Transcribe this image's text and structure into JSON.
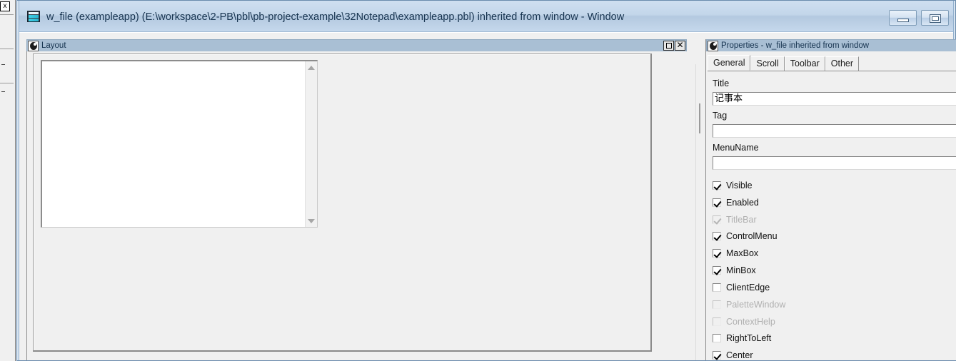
{
  "window": {
    "title": "w_file (exampleapp) (E:\\workspace\\2-PB\\pbl\\pb-project-example\\32Notepad\\exampleapp.pbl) inherited from window - Window",
    "icon": "window-painter-icon",
    "caption_buttons": [
      {
        "name": "minimize-button",
        "glyph": "minimize"
      },
      {
        "name": "restore-button",
        "glyph": "restore"
      }
    ]
  },
  "left_sliver": {
    "close_label": "x"
  },
  "layout_pane": {
    "title": "Layout",
    "icon": "powerbuilder-painter-icon",
    "buttons": [
      {
        "name": "maximize-button",
        "glyph": "maximize"
      },
      {
        "name": "close-button",
        "glyph": "close",
        "label": "✕"
      }
    ],
    "design": {
      "controls": [
        {
          "name": "multiline-edit",
          "type": "mle",
          "value": ""
        }
      ],
      "scrollbar": {
        "up_arrow": "scroll-up-arrow",
        "down_arrow": "scroll-down-arrow"
      }
    }
  },
  "properties_pane": {
    "title": "Properties - w_file inherited from window",
    "icon": "powerbuilder-painter-icon",
    "tabs": [
      {
        "label": "General",
        "active": true
      },
      {
        "label": "Scroll",
        "active": false
      },
      {
        "label": "Toolbar",
        "active": false
      },
      {
        "label": "Other",
        "active": false
      }
    ],
    "fields": [
      {
        "label": "Title",
        "value": "记事本",
        "name": "title-field"
      },
      {
        "label": "Tag",
        "value": "",
        "name": "tag-field"
      },
      {
        "label": "MenuName",
        "value": "",
        "name": "menuname-field"
      }
    ],
    "checkboxes": [
      {
        "label": "Visible",
        "checked": true,
        "disabled": false
      },
      {
        "label": "Enabled",
        "checked": true,
        "disabled": false
      },
      {
        "label": "TitleBar",
        "checked": true,
        "disabled": true
      },
      {
        "label": "ControlMenu",
        "checked": true,
        "disabled": false
      },
      {
        "label": "MaxBox",
        "checked": true,
        "disabled": false
      },
      {
        "label": "MinBox",
        "checked": true,
        "disabled": false
      },
      {
        "label": "ClientEdge",
        "checked": false,
        "disabled": false
      },
      {
        "label": "PaletteWindow",
        "checked": false,
        "disabled": true
      },
      {
        "label": "ContextHelp",
        "checked": false,
        "disabled": true
      },
      {
        "label": "RightToLeft",
        "checked": false,
        "disabled": false
      },
      {
        "label": "Center",
        "checked": true,
        "disabled": false
      }
    ]
  },
  "colors": {
    "titlebar": "#c3d6ea",
    "pane_caption": "#a9bfd4",
    "workspace": "#f0f0f0",
    "control_white": "#ffffff",
    "border": "#8d8d8d"
  }
}
